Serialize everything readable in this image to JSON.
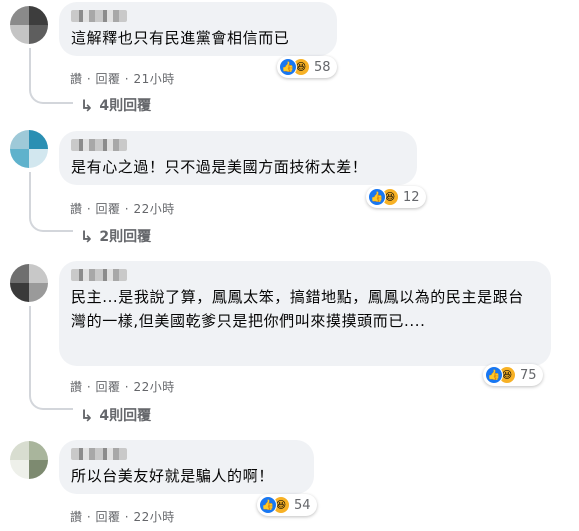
{
  "comments": [
    {
      "text": "這解釋也只有民進黨會相信而已",
      "reaction_count": "58",
      "like": "讚",
      "reply": "回覆",
      "time": "21小時",
      "replies": "4則回覆",
      "avatar_colors": [
        "#8a8a8a",
        "#3d3d3d",
        "#c4c4c4",
        "#5e5e5e"
      ]
    },
    {
      "text": "是有心之過！只不過是美國方面技術太差！",
      "reaction_count": "12",
      "like": "讚",
      "reply": "回覆",
      "time": "22小時",
      "replies": "2則回覆",
      "avatar_colors": [
        "#9ec9d8",
        "#2a8fb3",
        "#5fb2cc",
        "#d2e7ef"
      ]
    },
    {
      "text": "民主...是我說了算，鳳鳳太笨，搞錯地點，鳳鳳以為的民主是跟台灣的一樣,但美國乾爹只是把你們叫來摸摸頭而已....",
      "reaction_count": "75",
      "like": "讚",
      "reply": "回覆",
      "time": "22小時",
      "replies": "4則回覆",
      "avatar_colors": [
        "#6f6f6f",
        "#c8c8c8",
        "#3a3a3a",
        "#9a9a9a"
      ]
    },
    {
      "text": "所以台美友好就是騙人的啊！",
      "reaction_count": "54",
      "like": "讚",
      "reply": "回覆",
      "time": "22小時",
      "avatar_colors": [
        "#d8ddd0",
        "#a9b59c",
        "#eef0ea",
        "#7d8a70"
      ]
    }
  ],
  "separator": " · ",
  "icons": {
    "like": "thumbs-up-icon",
    "haha": "laughing-face-icon",
    "reply_arrow": "reply-arrow-icon"
  }
}
